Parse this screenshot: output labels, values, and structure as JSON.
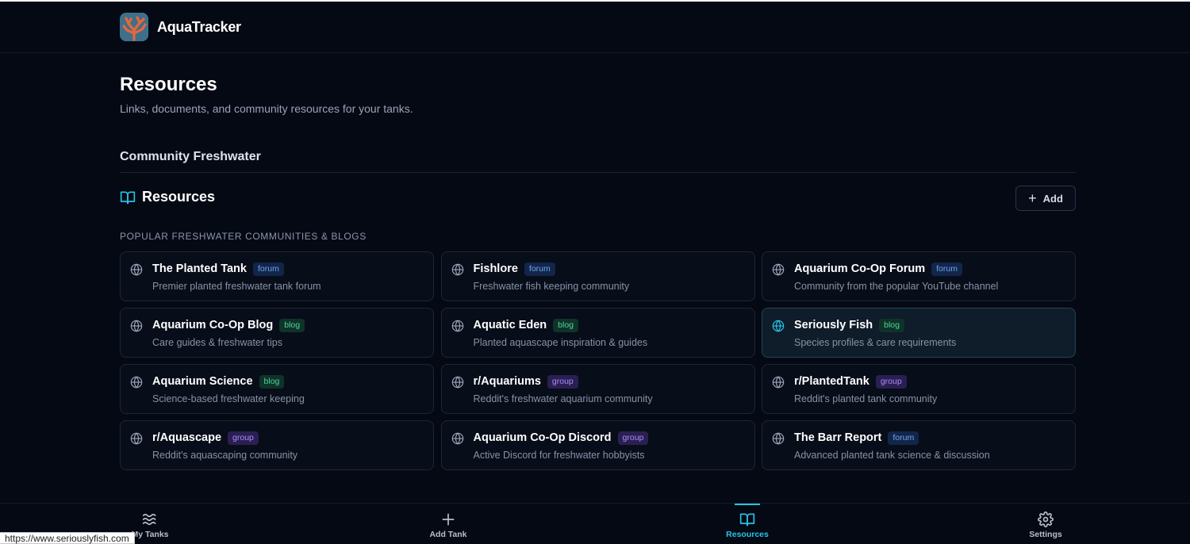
{
  "app": {
    "title": "AquaTracker"
  },
  "page": {
    "title": "Resources",
    "subtitle": "Links, documents, and community resources for your tanks.",
    "tank_name": "Community Freshwater"
  },
  "section": {
    "title": "Resources",
    "add_label": "Add",
    "group_label": "Popular Freshwater Communities & Blogs"
  },
  "resources": [
    {
      "name": "The Planted Tank",
      "type": "forum",
      "desc": "Premier planted freshwater tank forum"
    },
    {
      "name": "Fishlore",
      "type": "forum",
      "desc": "Freshwater fish keeping community"
    },
    {
      "name": "Aquarium Co-Op Forum",
      "type": "forum",
      "desc": "Community from the popular YouTube channel"
    },
    {
      "name": "Aquarium Co-Op Blog",
      "type": "blog",
      "desc": "Care guides & freshwater tips"
    },
    {
      "name": "Aquatic Eden",
      "type": "blog",
      "desc": "Planted aquascape inspiration & guides"
    },
    {
      "name": "Seriously Fish",
      "type": "blog",
      "desc": "Species profiles & care requirements"
    },
    {
      "name": "Aquarium Science",
      "type": "blog",
      "desc": "Science-based freshwater keeping"
    },
    {
      "name": "r/Aquariums",
      "type": "group",
      "desc": "Reddit's freshwater aquarium community"
    },
    {
      "name": "r/PlantedTank",
      "type": "group",
      "desc": "Reddit's planted tank community"
    },
    {
      "name": "r/Aquascape",
      "type": "group",
      "desc": "Reddit's aquascaping community"
    },
    {
      "name": "Aquarium Co-Op Discord",
      "type": "group",
      "desc": "Active Discord for freshwater hobbyists"
    },
    {
      "name": "The Barr Report",
      "type": "forum",
      "desc": "Advanced planted tank science & discussion"
    }
  ],
  "nav": {
    "my_tanks": "My Tanks",
    "add_tank": "Add Tank",
    "resources": "Resources",
    "settings": "Settings"
  },
  "status_bar": {
    "url": "https://www.seriouslyfish.com"
  },
  "colors": {
    "accent": "#27c4e6",
    "background": "#050914"
  }
}
